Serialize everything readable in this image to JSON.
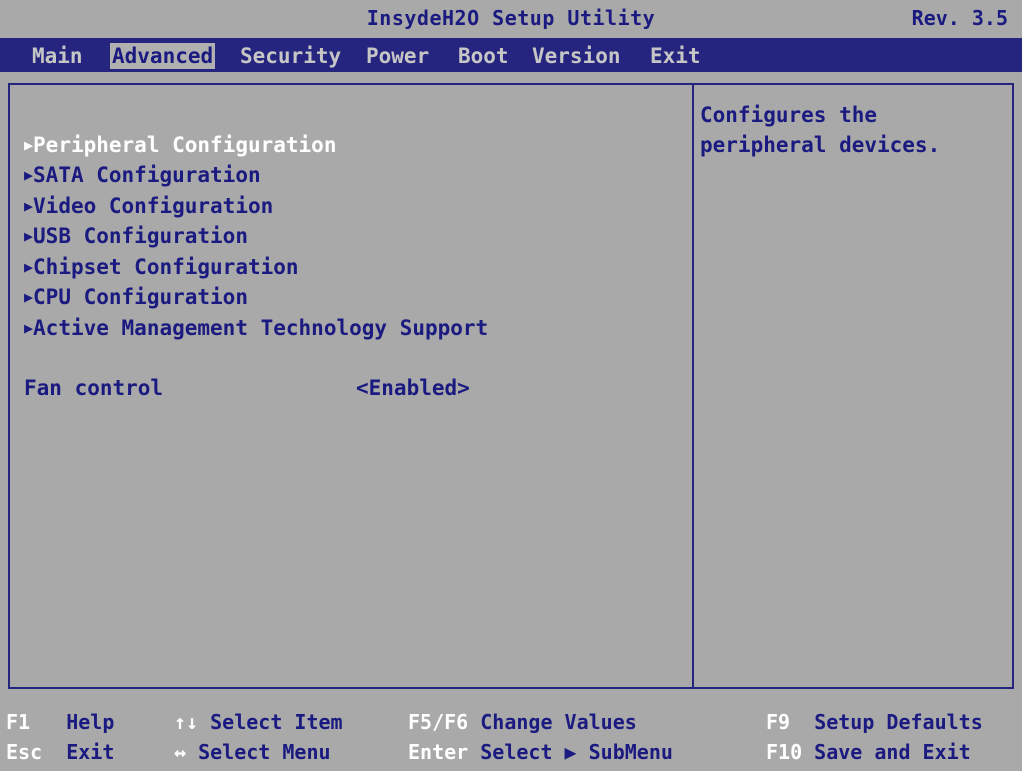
{
  "header": {
    "title": "InsydeH2O Setup Utility",
    "rev": "Rev. 3.5"
  },
  "menu": {
    "tabs": [
      {
        "label": "Main"
      },
      {
        "label": "Advanced"
      },
      {
        "label": "Security"
      },
      {
        "label": "Power"
      },
      {
        "label": "Boot"
      },
      {
        "label": "Version"
      },
      {
        "label": "Exit"
      }
    ],
    "active": "Advanced"
  },
  "main": {
    "items": [
      {
        "label": "Peripheral Configuration",
        "icon": "right-triangle-icon"
      },
      {
        "label": "SATA Configuration",
        "icon": "right-triangle-icon"
      },
      {
        "label": "Video Configuration",
        "icon": "right-triangle-icon"
      },
      {
        "label": "USB Configuration",
        "icon": "right-triangle-icon"
      },
      {
        "label": "Chipset Configuration",
        "icon": "right-triangle-icon"
      },
      {
        "label": "CPU Configuration",
        "icon": "right-triangle-icon"
      },
      {
        "label": "Active Management Technology Support",
        "icon": "right-triangle-icon"
      }
    ],
    "fan": {
      "label": "Fan control",
      "value": "<Enabled>"
    }
  },
  "help": {
    "lines": [
      "Configures the",
      "peripheral devices."
    ]
  },
  "footer": {
    "row1": [
      {
        "key": "F1",
        "desc": "Help"
      },
      {
        "key": "↑↓",
        "desc": "Select Item"
      },
      {
        "key": "F5/F6",
        "desc": "Change Values"
      },
      {
        "key": "F9",
        "desc": "Setup Defaults"
      }
    ],
    "row2": [
      {
        "key": "Esc",
        "desc": "Exit"
      },
      {
        "key": "↔",
        "desc": "Select Menu"
      },
      {
        "key": "Enter",
        "desc": "Select ▶ SubMenu"
      },
      {
        "key": "F10",
        "desc": "Save and Exit"
      }
    ]
  },
  "colors": {
    "background": "#a9a9a9",
    "menubar": "#25257f",
    "text": "#1a1a80",
    "highlight": "#ffffff"
  }
}
